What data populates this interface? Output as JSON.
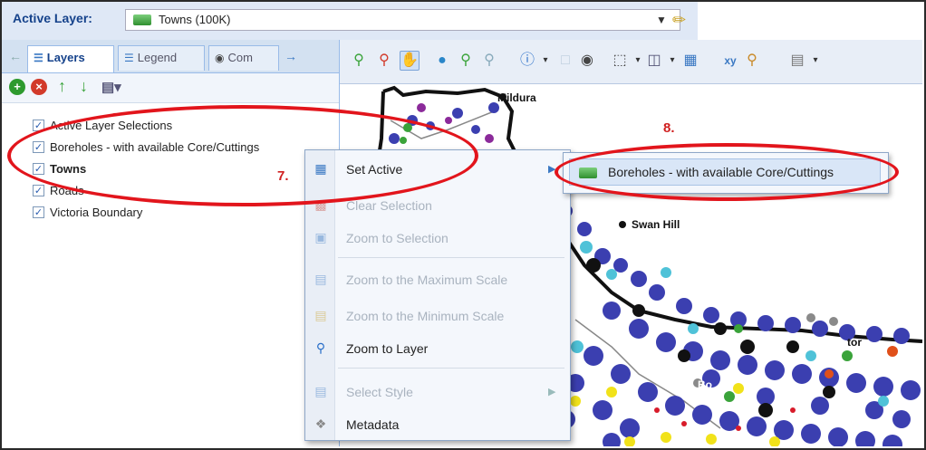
{
  "active_layer_bar": {
    "label": "Active Layer:",
    "selected_value": "Towns (100K)"
  },
  "tabs": [
    {
      "label": "Layers"
    },
    {
      "label": "Legend"
    },
    {
      "label": "Com"
    }
  ],
  "layers": [
    {
      "label": "Active Layer Selections",
      "checked": true
    },
    {
      "label": "Boreholes - with available Core/Cuttings",
      "checked": true
    },
    {
      "label": "Towns",
      "checked": true
    },
    {
      "label": "Roads",
      "checked": true
    },
    {
      "label": "Victoria Boundary",
      "checked": true
    }
  ],
  "context_menu": {
    "items": [
      {
        "label": "Set Active",
        "enabled": true
      },
      {
        "label": "Clear Selection",
        "enabled": false
      },
      {
        "label": "Zoom to Selection",
        "enabled": false
      },
      {
        "label": "Zoom to the Maximum Scale",
        "enabled": false
      },
      {
        "label": "Zoom to the Minimum Scale",
        "enabled": false
      },
      {
        "label": "Zoom to Layer",
        "enabled": true
      },
      {
        "label": "Select Style",
        "enabled": false
      },
      {
        "label": "Metadata",
        "enabled": true
      }
    ]
  },
  "submenu": {
    "item": "Boreholes - with available Core/Cuttings"
  },
  "map": {
    "towns": [
      "Mildura",
      "Swan Hill",
      "Bo",
      "tor"
    ]
  },
  "annotations": {
    "step7": "7.",
    "step8": "8."
  },
  "colors": {
    "annotation_red": "#e2151c",
    "header_blue": "#dfe8f6",
    "borehole_blue": "#3b3fb0"
  }
}
